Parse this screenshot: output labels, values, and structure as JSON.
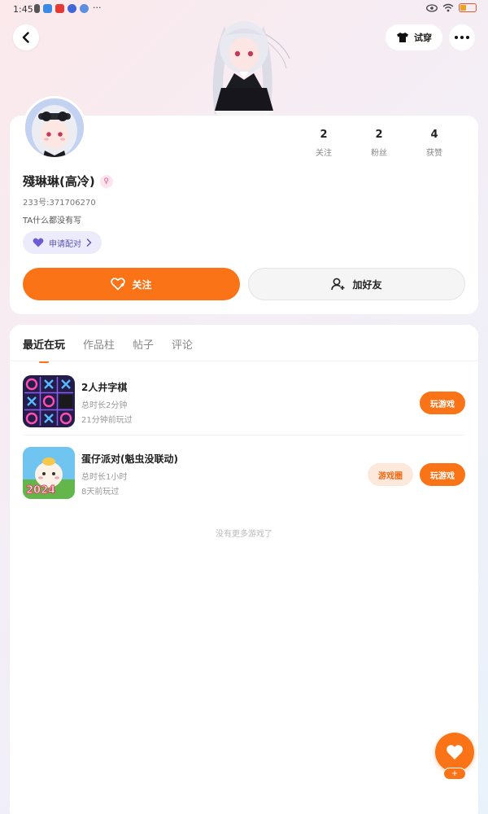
{
  "status_bar": {
    "time": "1:45",
    "more": "···",
    "notification_icons": [
      "sim-icon",
      "cloud-icon",
      "app-red-icon",
      "app-blue-icon",
      "app-blue2-icon"
    ],
    "right_icons": [
      "eye-icon",
      "wifi-icon",
      "battery-icon"
    ]
  },
  "header": {
    "tryon_label": "试穿"
  },
  "profile": {
    "username": "殘琳琳(高冷)",
    "uid": "233号:371706270",
    "bio": "TA什么都没有写",
    "pair_label": "申请配对",
    "stats": [
      {
        "value": "2",
        "label": "关注"
      },
      {
        "value": "2",
        "label": "粉丝"
      },
      {
        "value": "4",
        "label": "获赞"
      }
    ],
    "follow_label": "关注",
    "add_friend_label": "加好友"
  },
  "tabs": [
    {
      "label": "最近在玩",
      "active": true
    },
    {
      "label": "作品柱",
      "active": false
    },
    {
      "label": "帖子",
      "active": false
    },
    {
      "label": "评论",
      "active": false
    }
  ],
  "games": [
    {
      "name": "2人井字棋",
      "playtime": "总时长2分钟",
      "last_played": "21分钟前玩过",
      "play_label": "玩游戏"
    },
    {
      "name": "蛋仔派对(魁虫没联动)",
      "playtime": "总时长1小时",
      "last_played": "8天前玩过",
      "circle_label": "游戏圈",
      "play_label": "玩游戏",
      "thumb_text": "2024"
    }
  ],
  "footer_text": "没有更多游戏了",
  "fab": {
    "badge": "+"
  },
  "colors": {
    "accent": "#fa7316",
    "pair_bg": "#ecebfb",
    "pair_text": "#5a56b8"
  }
}
